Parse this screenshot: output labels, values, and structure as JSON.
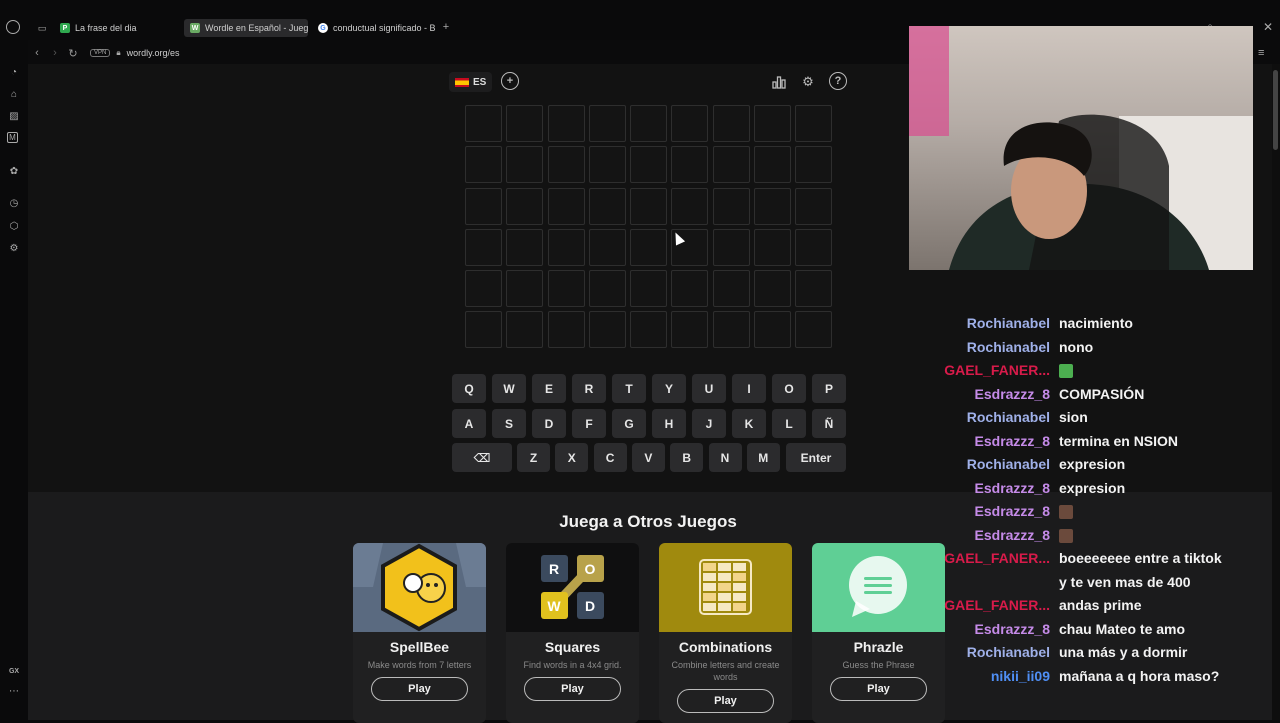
{
  "browser": {
    "tabs": [
      {
        "label": "La frase del dia",
        "favicon_letter": "P",
        "favicon_color": "#2fa84f"
      },
      {
        "label": "Wordle en Español - Jueg",
        "favicon_letter": "W",
        "favicon_color": "#6aaa64"
      },
      {
        "label": "conductual significado - B",
        "favicon_letter": "G",
        "favicon_color": "#4285f4"
      }
    ],
    "new_tab": "+",
    "vpn_label": "VPN",
    "url": "wordly.org/es",
    "sidebar_bottom_label": "GX"
  },
  "game": {
    "language": "ES",
    "keyboard": {
      "row1": [
        "Q",
        "W",
        "E",
        "R",
        "T",
        "Y",
        "U",
        "I",
        "O",
        "P"
      ],
      "row2": [
        "A",
        "S",
        "D",
        "F",
        "G",
        "H",
        "J",
        "K",
        "L",
        "Ñ"
      ],
      "row3": [
        "Z",
        "X",
        "C",
        "V",
        "B",
        "N",
        "M"
      ],
      "enter_label": "Enter",
      "backspace_glyph": "⌫"
    }
  },
  "other_games": {
    "title": "Juega a Otros Juegos",
    "cards": [
      {
        "title": "SpellBee",
        "desc": "Make words from 7 letters",
        "play": "Play",
        "color": "#5a6a80"
      },
      {
        "title": "Squares",
        "desc": "Find words in a 4x4 grid.",
        "play": "Play",
        "color": "#0f0f10"
      },
      {
        "title": "Combinations",
        "desc": "Combine letters and create words",
        "play": "Play",
        "color": "#a08a0e"
      },
      {
        "title": "Phrazle",
        "desc": "Guess the Phrase",
        "play": "Play",
        "color": "#5fcf95"
      }
    ],
    "squares_letters": [
      "R",
      "O",
      "W",
      "D"
    ]
  },
  "chat": {
    "messages": [
      {
        "user": "Rochianabel",
        "text": "nacimiento",
        "color": "#9fb0e8"
      },
      {
        "user": "Rochianabel",
        "text": "nono",
        "color": "#9fb0e8"
      },
      {
        "user": "GAEL_FANER...",
        "text": "",
        "color": "#d81b4a"
      },
      {
        "user": "Esdrazzz_8",
        "text": "COMPASIÓN",
        "color": "#c58be8"
      },
      {
        "user": "Rochianabel",
        "text": "sion",
        "color": "#9fb0e8"
      },
      {
        "user": "Esdrazzz_8",
        "text": "termina en NSION",
        "color": "#c58be8"
      },
      {
        "user": "Rochianabel",
        "text": "expresion",
        "color": "#9fb0e8"
      },
      {
        "user": "Esdrazzz_8",
        "text": "expresion",
        "color": "#c58be8"
      },
      {
        "user": "Esdrazzz_8",
        "text": "",
        "color": "#c58be8"
      },
      {
        "user": "Esdrazzz_8",
        "text": "",
        "color": "#c58be8"
      },
      {
        "user": "GAEL_FANER...",
        "text": "boeeeeeee entre a tiktok",
        "color": "#d81b4a"
      },
      {
        "user": "",
        "text": "y te ven mas de 400",
        "color": "#d81b4a"
      },
      {
        "user": "GAEL_FANER...",
        "text": "andas prime",
        "color": "#d81b4a"
      },
      {
        "user": "Esdrazzz_8",
        "text": "chau Mateo te amo",
        "color": "#c58be8"
      },
      {
        "user": "Rochianabel",
        "text": "una más y a dormir",
        "color": "#9fb0e8"
      },
      {
        "user": "nikii_ii09",
        "text": "mañana a q hora maso?",
        "color": "#4f8ff5"
      }
    ]
  }
}
